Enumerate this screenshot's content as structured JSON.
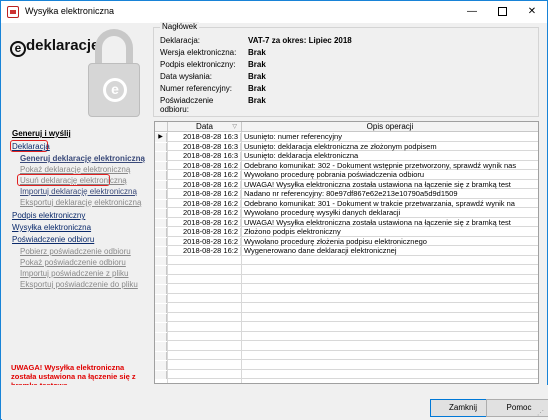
{
  "window": {
    "title": "Wysyłka elektroniczna",
    "minimize_glyph": "—",
    "close_glyph": "✕"
  },
  "logo": {
    "text": "deklaracje",
    "e_glyph": "e",
    "padlock_glyph": "e"
  },
  "header": {
    "legend": "Nagłówek",
    "rows": [
      {
        "label": "Deklaracja:",
        "value": "VAT-7 za okres: Lipiec 2018"
      },
      {
        "label": "Wersja elektroniczna:",
        "value": "Brak"
      },
      {
        "label": "Podpis elektroniczny:",
        "value": "Brak"
      },
      {
        "label": "Data wysłania:",
        "value": "Brak"
      },
      {
        "label": "Numer referencyjny:",
        "value": "Brak"
      },
      {
        "label": "Poświadczenie odbioru:",
        "value": "Brak"
      }
    ]
  },
  "sidebar": {
    "items": [
      {
        "label": "Generuj i wyślij"
      },
      {
        "label": "Deklaracja"
      },
      {
        "label": "Generuj deklarację elektroniczną"
      },
      {
        "label": "Pokaż deklarację elektroniczną"
      },
      {
        "label": "Usuń deklarację elektroniczną"
      },
      {
        "label": "Importuj deklarację elektroniczną"
      },
      {
        "label": "Eksportuj deklarację elektroniczną"
      },
      {
        "label": "Podpis elektroniczny"
      },
      {
        "label": "Wysyłka elektroniczna"
      },
      {
        "label": "Poświadczenie odbioru"
      },
      {
        "label": "Pobierz poświadczenie odbioru"
      },
      {
        "label": "Pokaż poświadczenie odbioru"
      },
      {
        "label": "Importuj poświadczenie z pliku"
      },
      {
        "label": "Eksportuj poświadczenie do pliku"
      }
    ],
    "warning": "UWAGA! Wysyłka elektroniczna została ustawiona na łączenie się z bramką testową."
  },
  "grid": {
    "columns": [
      "Data",
      "Opis operacji"
    ],
    "current_row_glyph": "▶",
    "rows": [
      {
        "date": "2018-08-28 16:3",
        "op": "Usunięto: numer referencyjny"
      },
      {
        "date": "2018-08-28 16:3",
        "op": "Usunięto: deklaracja elektroniczna ze złożonym podpisem"
      },
      {
        "date": "2018-08-28 16:3",
        "op": "Usunięto: deklaracja elektroniczna"
      },
      {
        "date": "2018-08-28 16:2",
        "op": "Odebrano komunikat: 302 - Dokument wstępnie przetworzony, sprawdź wynik nas"
      },
      {
        "date": "2018-08-28 16:2",
        "op": "Wywołano procedurę pobrania poświadczenia odbioru"
      },
      {
        "date": "2018-08-28 16:2",
        "op": "UWAGA! Wysyłka elektroniczna została ustawiona na łączenie się z bramką test"
      },
      {
        "date": "2018-08-28 16:2",
        "op": "Nadano nr referencyjny: 80e97df867e62e213e10790a5d9d1509"
      },
      {
        "date": "2018-08-28 16:2",
        "op": "Odebrano komunikat: 301 - Dokument w trakcie przetwarzania, sprawdź wynik na"
      },
      {
        "date": "2018-08-28 16:2",
        "op": "Wywołano procedurę wysyłki danych deklaracji"
      },
      {
        "date": "2018-08-28 16:2",
        "op": "UWAGA! Wysyłka elektroniczna została ustawiona na łączenie się z bramką test"
      },
      {
        "date": "2018-08-28 16:2",
        "op": "Złożono podpis elektroniczny"
      },
      {
        "date": "2018-08-28 16:2",
        "op": "Wywołano procedurę złożenia podpisu elektronicznego"
      },
      {
        "date": "2018-08-28 16:2",
        "op": "Wygenerowano dane deklaracji elektronicznej"
      }
    ]
  },
  "buttons": {
    "close": "Zamknij",
    "help": "Pomoc"
  }
}
